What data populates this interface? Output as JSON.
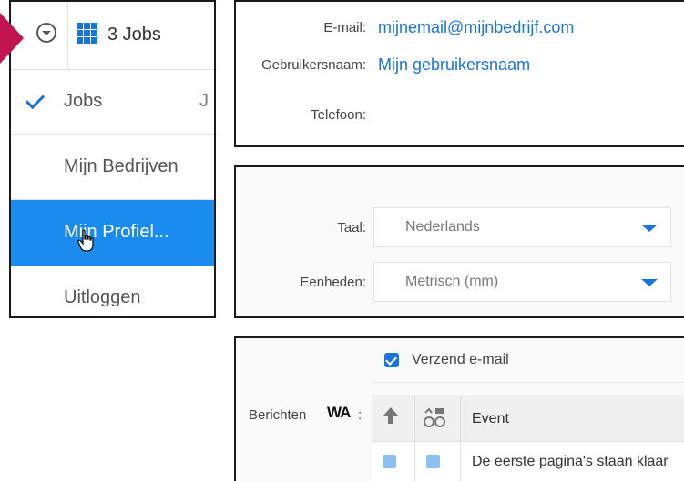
{
  "menu": {
    "jobs_count": "3 Jobs",
    "items": [
      {
        "label": "Jobs",
        "checked": true
      },
      {
        "label": "Mijn Bedrijven"
      },
      {
        "label": "Mijn Profiel...",
        "selected": true
      },
      {
        "label": "Uitloggen"
      }
    ],
    "side_letter": "J"
  },
  "profile": {
    "email_label": "E-mail:",
    "email_value": "mijnemail@mijnbedrijf.com",
    "username_label": "Gebruikersnaam:",
    "username_value": "Mijn gebruikersnaam",
    "phone_label": "Telefoon:",
    "phone_value": ""
  },
  "settings": {
    "language_label": "Taal:",
    "language_value": "Nederlands",
    "units_label": "Eenheden:",
    "units_value": "Metrisch (mm)"
  },
  "messages": {
    "send_email_label": "Verzend e-mail",
    "send_email_checked": true,
    "label": "Berichten",
    "wa_icon_text": "WA",
    "colon": ":",
    "event_header": "Event",
    "row_text": "De eerste pagina's staan klaar"
  },
  "colors": {
    "accent": "#1a73d9",
    "selected_bg": "#1a8cf0",
    "arrow": "#c2144e"
  }
}
